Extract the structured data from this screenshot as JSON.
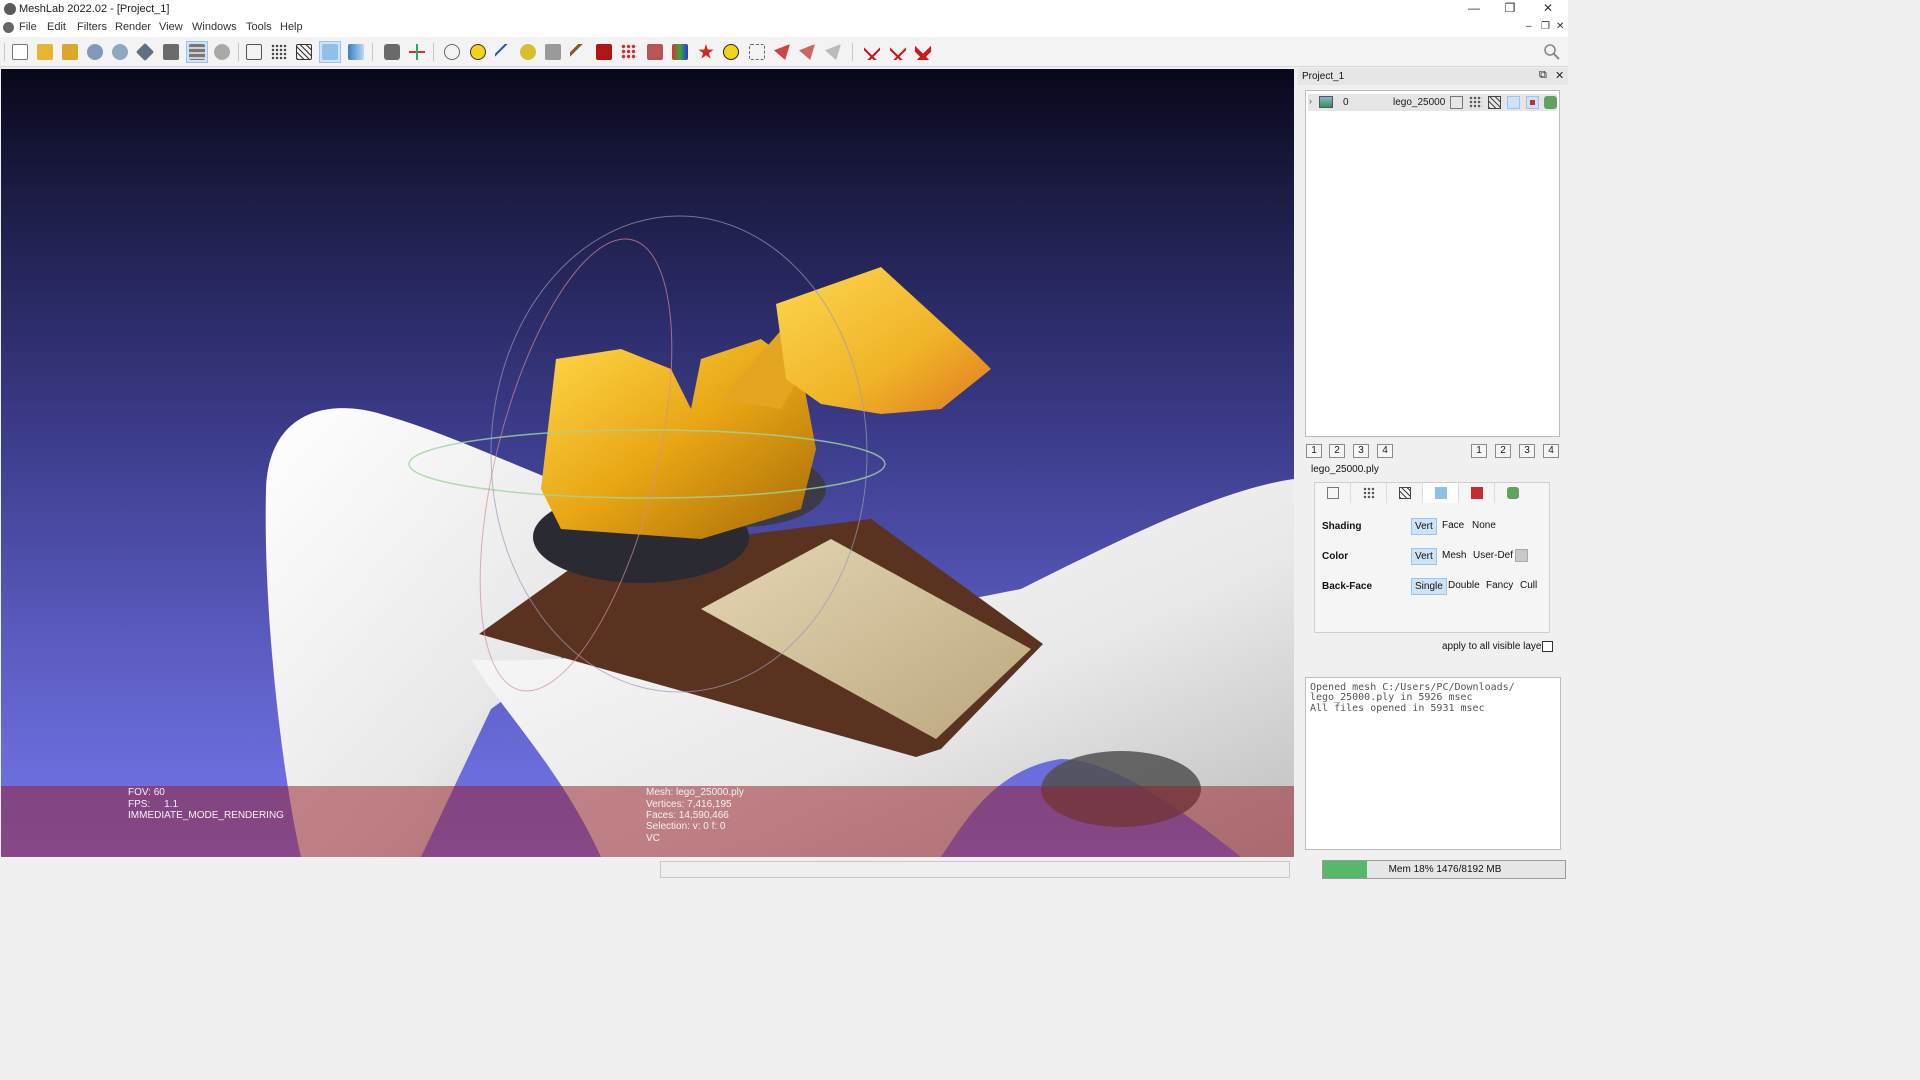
{
  "window": {
    "title": "MeshLab 2022.02 - [Project_1]",
    "controls": {
      "minimize": "—",
      "restore": "❐",
      "close": "✕"
    }
  },
  "menu": [
    "File",
    "Edit",
    "Filters",
    "Render",
    "View",
    "Windows",
    "Tools",
    "Help"
  ],
  "mdi_controls": {
    "minimize": "–",
    "restore": "❐",
    "close": "✕"
  },
  "toolbar": {
    "groups": [
      [
        "new-project-icon",
        "open-project-icon",
        "import-mesh-icon",
        "reload-icon",
        "reload-all-icon",
        "export-mesh-icon",
        "snapshot-icon",
        "layers-dialog-icon",
        "raster-layers-icon"
      ],
      [
        "bbox-icon",
        "points-icon",
        "wireframe-icon",
        "flat-icon",
        "smooth-icon"
      ],
      [
        "show-normals-icon",
        "show-axis-icon"
      ],
      [
        "trackball-icon",
        "annotation-icon",
        "measure-icon",
        "align-icon",
        "camera-icon",
        "paint-icon",
        "raster-icon",
        "select-vertices-icon",
        "select-faces-icon",
        "color-paint-icon",
        "quality-icon",
        "info-icon",
        "select-region-icon",
        "pickpoints-icon",
        "select-connected-icon",
        "select-all-icon"
      ],
      [
        "delete-vertices-icon",
        "delete-faces-icon",
        "delete-selection-icon"
      ]
    ],
    "active": [
      "layers-dialog-icon",
      "flat-icon"
    ],
    "search_icon": "search-icon"
  },
  "viewport": {
    "hud_left": [
      "FOV: 60",
      "FPS:     1.1",
      "IMMEDIATE_MODE_RENDERING"
    ],
    "hud_right": [
      "Mesh: lego_25000.ply",
      "Vertices: 7,416,195",
      "Faces: 14,590,466",
      "Selection: v: 0 f: 0",
      "VC"
    ]
  },
  "dock": {
    "title": "Project_1",
    "float_icon": "⧉",
    "close_icon": "✕",
    "layers": [
      {
        "expand": "›",
        "index": "0",
        "name": "lego_25000",
        "visible": true
      }
    ],
    "pages_left": [
      "1",
      "2",
      "3",
      "4"
    ],
    "pages_right": [
      "1",
      "2",
      "3",
      "4"
    ],
    "mesh_file": "lego_25000.ply",
    "render_tabs": [
      "bbox-tab-icon",
      "points-tab-icon",
      "wire-tab-icon",
      "fill-tab-icon",
      "texture-tab-icon",
      "other-tab-icon"
    ],
    "active_render_tab": 3,
    "shading": {
      "label": "Shading",
      "options": [
        "Vert",
        "Face",
        "None"
      ],
      "selected": "Vert"
    },
    "color": {
      "label": "Color",
      "options": [
        "Vert",
        "Mesh",
        "User-Def"
      ],
      "selected": "Vert",
      "user_color": "#c8c8c8"
    },
    "backface": {
      "label": "Back-Face",
      "options": [
        "Single",
        "Double",
        "Fancy",
        "Cull"
      ],
      "selected": "Single"
    },
    "apply_all_label": "apply to all visible layers",
    "apply_all_checked": false,
    "log": [
      "Opened mesh C:/Users/PC/Downloads/",
      "lego_25000.ply in 5926 msec",
      "All files opened in 5931 msec"
    ]
  },
  "status": {
    "memory_label": "Mem 18% 1476/8192 MB",
    "memory_fraction": 0.18
  }
}
